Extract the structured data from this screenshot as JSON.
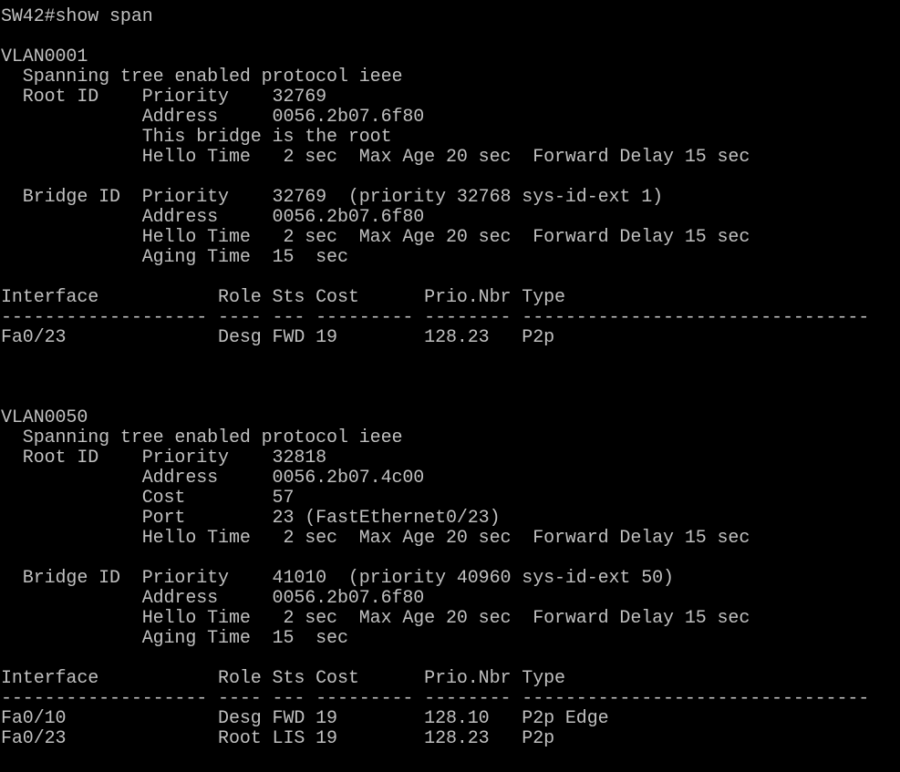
{
  "terminal": {
    "lines": [
      "SW42#show span",
      "",
      "VLAN0001",
      "  Spanning tree enabled protocol ieee",
      "  Root ID    Priority    32769",
      "             Address     0056.2b07.6f80",
      "             This bridge is the root",
      "             Hello Time   2 sec  Max Age 20 sec  Forward Delay 15 sec",
      "",
      "  Bridge ID  Priority    32769  (priority 32768 sys-id-ext 1)",
      "             Address     0056.2b07.6f80",
      "             Hello Time   2 sec  Max Age 20 sec  Forward Delay 15 sec",
      "             Aging Time  15  sec",
      "",
      "Interface           Role Sts Cost      Prio.Nbr Type",
      "------------------- ---- --- --------- -------- --------------------------------",
      "Fa0/23              Desg FWD 19        128.23   P2p",
      "",
      "",
      "",
      "VLAN0050",
      "  Spanning tree enabled protocol ieee",
      "  Root ID    Priority    32818",
      "             Address     0056.2b07.4c00",
      "             Cost        57",
      "             Port        23 (FastEthernet0/23)",
      "             Hello Time   2 sec  Max Age 20 sec  Forward Delay 15 sec",
      "",
      "  Bridge ID  Priority    41010  (priority 40960 sys-id-ext 50)",
      "             Address     0056.2b07.6f80",
      "             Hello Time   2 sec  Max Age 20 sec  Forward Delay 15 sec",
      "             Aging Time  15  sec",
      "",
      "Interface           Role Sts Cost      Prio.Nbr Type",
      "------------------- ---- --- --------- -------- --------------------------------",
      "Fa0/10              Desg FWD 19        128.10   P2p Edge",
      "Fa0/23              Root LIS 19        128.23   P2p"
    ]
  },
  "colors": {
    "background": "#000000",
    "text": "#c0c0c0"
  }
}
